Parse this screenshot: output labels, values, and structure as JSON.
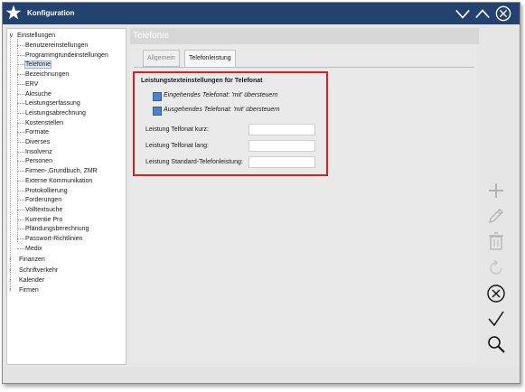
{
  "window": {
    "title": "Konfiguration",
    "colors": {
      "titlebar": "#24426f",
      "accent": "#4f83c4",
      "highlight_border": "#d9211f"
    }
  },
  "titlebar_controls": [
    "chevron-down-icon",
    "chevron-up-icon",
    "close-circle-icon"
  ],
  "tree": {
    "root": "Einstellungen",
    "children": [
      "Benutzereinstellungen",
      "Programmgrundeinstellungen",
      "Telefonie",
      "Bezeichnungen",
      "ERV",
      "Aktsuche",
      "Leistungserfassung",
      "Leistungsabrechnung",
      "Kostenstellen",
      "Formate",
      "Diverses",
      "Insolvenz",
      "Personen",
      "Firmen-,Grundbuch, ZMR",
      "Externe Kommunikation",
      "Protokollierung",
      "Forderungen",
      "Volltextsuche",
      "Kurrentie Pro",
      "Pfändungsberechnung",
      "Passwort-Richtlinien",
      "Medix"
    ],
    "selected": "Telefonie",
    "collapsed": [
      "Finanzen",
      "Schriftverkehr",
      "Kalender",
      "Firmen"
    ]
  },
  "content": {
    "header": "Telefonie",
    "tabs": [
      "Allgemein",
      "Telefonleistung"
    ],
    "active_tab": "Telefonleistung",
    "group": {
      "title": "Leistungstexteinstellungen für Telefonat",
      "checkboxes": [
        {
          "label": "Eingehendes Telefonat: 'mit' übersteuern",
          "checked": true
        },
        {
          "label": "Ausgehendes Telefonat: 'mit' übersteuern",
          "checked": true
        }
      ],
      "fields": [
        {
          "label": "Leistung Telfonat kurz:",
          "value": ""
        },
        {
          "label": "Leistung Telfonat lang:",
          "value": ""
        },
        {
          "label": "Leistung Standard-Telefonleistung:",
          "value": ""
        }
      ]
    }
  },
  "actions": [
    "add-icon",
    "edit-icon",
    "delete-icon",
    "refresh-icon",
    "cancel-icon",
    "confirm-icon",
    "search-icon"
  ]
}
